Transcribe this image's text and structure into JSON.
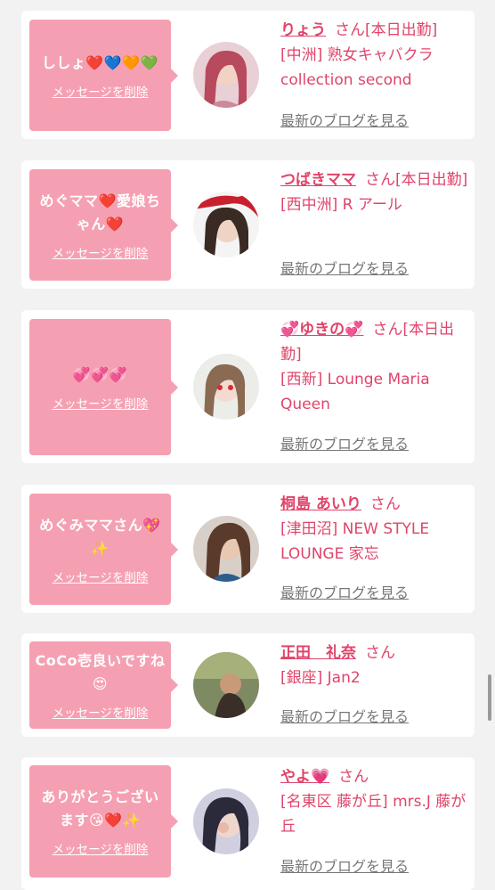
{
  "common": {
    "delete_label": "メッセージを削除",
    "san_label": "さん",
    "blog_label": "最新のブログを見る"
  },
  "cards": [
    {
      "message": "ししょ❤️💙🧡💚",
      "name": "りょう",
      "status": "[本日出勤]",
      "shop": "[中洲] 熟女キャバクラ collection second",
      "avatar_color": "#d9a3b0"
    },
    {
      "message": "めぐママ❤️愛娘ちゃん❤️",
      "name": "つばきママ",
      "status": "[本日出勤]",
      "shop": "[西中洲] R アール",
      "avatar_color": "#b06a5b"
    },
    {
      "message": "💞💞💞",
      "name": "💞ゆきの💞",
      "status": "[本日出勤]",
      "shop": "[西新] Lounge Maria Queen",
      "avatar_color": "#caa48a"
    },
    {
      "message": "めぐみママさん💖✨",
      "name": "桐島 あいり",
      "status": "",
      "shop": "[津田沼] NEW STYLE LOUNGE 家忘",
      "avatar_color": "#8a6a5c"
    },
    {
      "message": "CoCo壱良いですね😍",
      "name": "正田　礼奈",
      "status": "",
      "shop": "[銀座] Jan2",
      "avatar_color": "#6f7a5a"
    },
    {
      "message": "ありがとうございます😘❤️✨",
      "name": "やよ💗",
      "status": "",
      "shop": "[名東区 藤が丘] mrs.J 藤が丘",
      "avatar_color": "#5a5a7a"
    }
  ]
}
